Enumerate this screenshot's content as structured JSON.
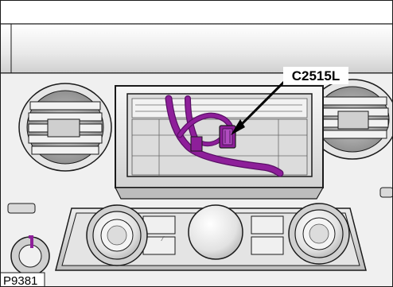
{
  "figure": {
    "top_caption": "",
    "connector_label": "C2515L",
    "figure_id": "P9381"
  },
  "colors": {
    "harness": "#8e1f9a",
    "harness_dark": "#5a0f66",
    "panel_light": "#f4f4f4",
    "panel_mid": "#d9d9d9",
    "panel_dark": "#9a9a9a",
    "outline": "#1a1a1a",
    "caption_green": "#2e8b2e"
  }
}
